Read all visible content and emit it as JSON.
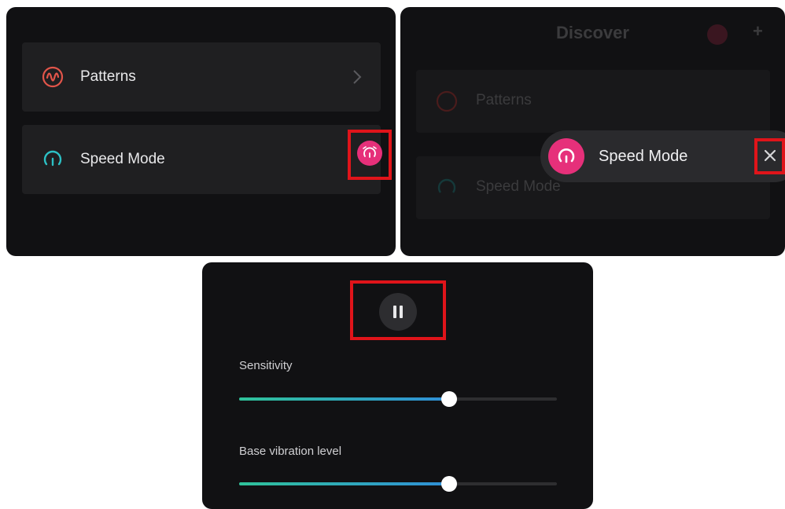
{
  "panel_list": {
    "items": [
      {
        "label": "Patterns",
        "icon": "patterns-wave-icon",
        "color": "#e2554a"
      },
      {
        "label": "Speed Mode",
        "icon": "speed-gauge-icon",
        "color": "#2cc0c4"
      }
    ],
    "floating_button_icon": "alarm-speed-icon"
  },
  "panel_discover": {
    "title": "Discover",
    "faded_items": [
      "Patterns",
      "Speed Mode"
    ],
    "pill_label": "Speed Mode",
    "close_icon": "close-icon"
  },
  "panel_controls": {
    "pause_icon": "pause-icon",
    "sliders": [
      {
        "label": "Sensitivity",
        "value_fraction": 0.66
      },
      {
        "label": "Base vibration level",
        "value_fraction": 0.66
      }
    ]
  },
  "colors": {
    "accent_pink": "#e6307a",
    "highlight_red": "#e0141a",
    "background": "#111113"
  }
}
